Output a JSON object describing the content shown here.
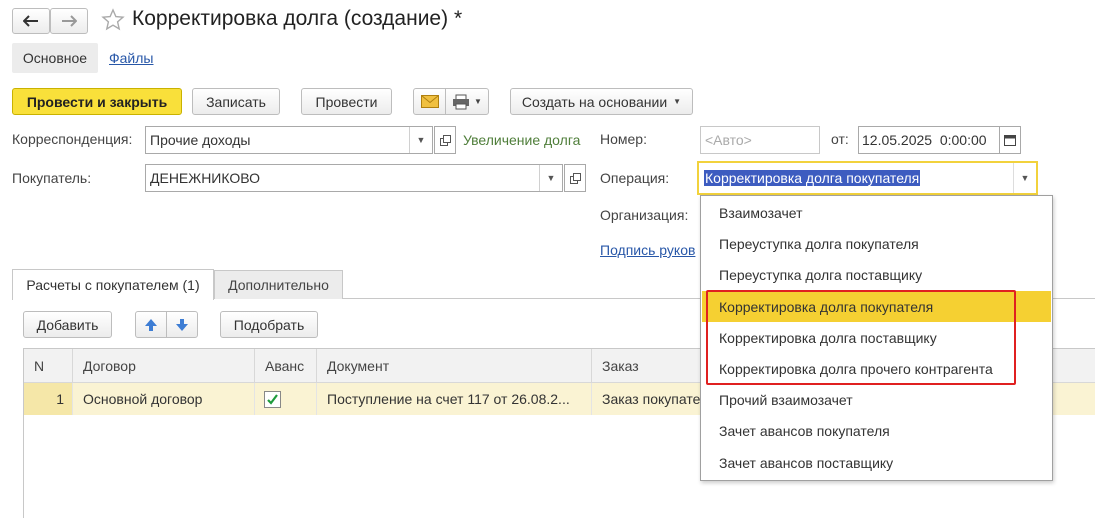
{
  "window": {
    "title": "Корректировка долга (создание) *",
    "back_icon": "arrow-left",
    "forward_icon": "arrow-right",
    "favorite_icon": "star"
  },
  "nav_tabs": [
    {
      "label": "Основное",
      "active": true
    },
    {
      "label": "Файлы",
      "active": false
    }
  ],
  "toolbar": {
    "post_close_label": "Провести и закрыть",
    "save_label": "Записать",
    "post_label": "Провести",
    "create_basis_label": "Создать на основании"
  },
  "form": {
    "correspondence_label": "Корреспонденция:",
    "correspondence_value": "Прочие доходы",
    "correspondence_hint": "Увеличение долга",
    "buyer_label": "Покупатель:",
    "buyer_value": "ДЕНЕЖНИКОВО",
    "number_label": "Номер:",
    "number_placeholder": "<Авто>",
    "date_label": "от:",
    "date_value": "12.05.2025  0:00:00",
    "operation_label": "Операция:",
    "operation_value": "Корректировка долга покупателя",
    "organization_label": "Организация:",
    "signature_link": "Подпись руков"
  },
  "content_tabs": [
    {
      "label": "Расчеты с покупателем (1)",
      "active": true
    },
    {
      "label": "Дополнительно",
      "active": false
    }
  ],
  "table_toolbar": {
    "add_label": "Добавить",
    "pick_label": "Подобрать"
  },
  "table": {
    "columns": [
      "N",
      "Договор",
      "Аванс",
      "Документ",
      "Заказ"
    ],
    "rows": [
      {
        "n": "1",
        "contract": "Основной договор",
        "advance": true,
        "document": "Поступление на счет 117 от 26.08.2...",
        "order": "Заказ покупате"
      }
    ]
  },
  "dropdown": {
    "items": [
      "Взаимозачет",
      "Переуступка долга покупателя",
      "Переуступка долга поставщику",
      "Корректировка долга покупателя",
      "Корректировка долга поставщику",
      "Корректировка долга прочего контрагента",
      "Прочий взаимозачет",
      "Зачет авансов покупателя",
      "Зачет авансов поставщику"
    ],
    "selected_index": 3
  },
  "colors": {
    "primary_button": "#f9e03a",
    "selected_item": "#f5d032",
    "row_highlight": "#faf3d3",
    "link": "#2857a8",
    "highlight_frame": "#e02020",
    "checkmark": "#1f9b3c"
  }
}
